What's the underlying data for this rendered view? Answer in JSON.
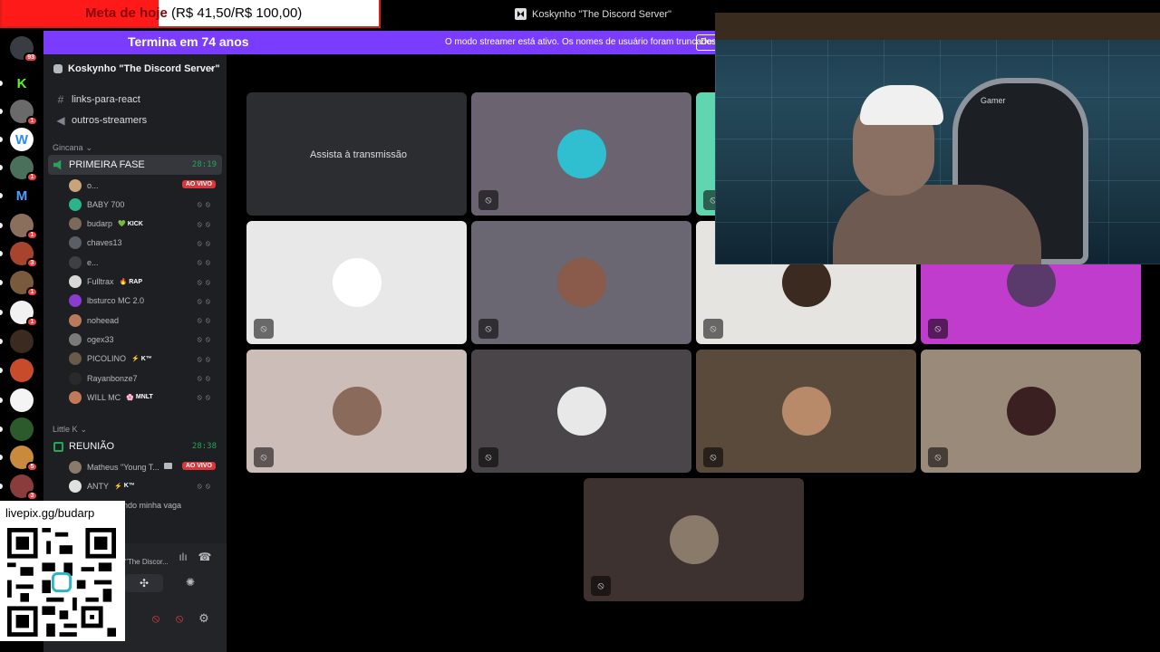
{
  "window": {
    "title": "Koskynho \"The Discord Server\""
  },
  "goal": {
    "label": "Meta de hoje",
    "amount": "(R$ 41,50/R$ 100,00)"
  },
  "banner": {
    "timer": "Termina em 74 anos",
    "notice": "O modo streamer está ativo. Os nomes de usuário foram truncados.",
    "dismiss": "Desativar"
  },
  "rail": {
    "servers": [
      {
        "icon": "discord-logo",
        "badge": "93",
        "color": "#3a3c43"
      },
      {
        "icon": "kick-logo",
        "badge": "",
        "color": "#000000",
        "glyph": "K",
        "glyph_color": "#53fc18"
      },
      {
        "icon": "server-avatar",
        "badge": "1",
        "color": "#6a6a6a"
      },
      {
        "icon": "server-avatar",
        "badge": "",
        "color": "#ffffff",
        "glyph": "W",
        "glyph_color": "#2c8cf4"
      },
      {
        "icon": "server-avatar",
        "badge": "1",
        "color": "#4a6f5b"
      },
      {
        "icon": "server-avatar",
        "badge": "",
        "color": "#000000",
        "glyph": "M",
        "glyph_color": "#4fa1ff"
      },
      {
        "icon": "server-avatar",
        "badge": "1",
        "color": "#8a6f5c"
      },
      {
        "icon": "server-avatar",
        "badge": "3",
        "color": "#a8442e"
      },
      {
        "icon": "server-avatar",
        "badge": "1",
        "color": "#7a5a3c"
      },
      {
        "icon": "server-avatar",
        "badge": "1",
        "color": "#f1f1f1"
      },
      {
        "icon": "server-avatar",
        "badge": "",
        "color": "#3a2a1f"
      },
      {
        "icon": "server-avatar",
        "badge": "",
        "color": "#c84c2c"
      },
      {
        "icon": "server-avatar",
        "badge": "",
        "color": "#f4f4f4"
      },
      {
        "icon": "server-avatar",
        "badge": "",
        "color": "#2c5a2c"
      },
      {
        "icon": "server-avatar",
        "badge": "5",
        "color": "#c88a3c"
      },
      {
        "icon": "server-avatar",
        "badge": "3",
        "color": "#8a3c3c"
      }
    ]
  },
  "sidebar": {
    "server_name": "Koskynho \"The Discord Server\"",
    "channels": [
      {
        "icon": "hash-icon",
        "label": "links-para-react"
      },
      {
        "icon": "megaphone-icon",
        "label": "outros-streamers"
      }
    ],
    "category_1": "Gincana",
    "voice_1": {
      "label": "PRIMEIRA FASE",
      "time": "28:19"
    },
    "voice_1_users": [
      {
        "name": "o...",
        "live": "AO VIVO",
        "tag": "",
        "color": "#c9a47a"
      },
      {
        "name": "BABY 700",
        "live": "",
        "tag": "",
        "color": "#2bb38c"
      },
      {
        "name": "budarp",
        "live": "",
        "tag": "KICK",
        "tag_emoji": "💚",
        "color": "#7b6a5a"
      },
      {
        "name": "chaves13",
        "live": "",
        "tag": "",
        "color": "#5a5f66"
      },
      {
        "name": "e...",
        "live": "",
        "tag": "",
        "color": "#3d3f45"
      },
      {
        "name": "Fulltrax",
        "live": "",
        "tag": "RAP",
        "tag_emoji": "🔥",
        "color": "#d8d8d8"
      },
      {
        "name": "lbsturco MC 2.0",
        "live": "",
        "tag": "",
        "color": "#8a3ccf"
      },
      {
        "name": "noheead",
        "live": "",
        "tag": "",
        "color": "#b87a5a"
      },
      {
        "name": "ogex33",
        "live": "",
        "tag": "",
        "color": "#7a7a7a"
      },
      {
        "name": "PICOLINO",
        "live": "",
        "tag": "K™",
        "tag_emoji": "⚡",
        "color": "#6a5a4a"
      },
      {
        "name": "Rayanbonze7",
        "live": "",
        "tag": "",
        "color": "#2a2a2a"
      },
      {
        "name": "WILL MC",
        "live": "",
        "tag": "MNLT",
        "tag_emoji": "🌸",
        "color": "#c07a5a"
      }
    ],
    "category_2": "Little K",
    "voice_2": {
      "label": "REUNIÃO",
      "time": "28:38"
    },
    "voice_2_users": [
      {
        "name": "Matheus \"Young T...",
        "live": "AO VIVO",
        "tag": "",
        "color": "#8a7a6a"
      },
      {
        "name": "ANTY",
        "live": "",
        "tag": "K™",
        "tag_emoji": "⚡",
        "color": "#e0e0e0"
      }
    ],
    "truncated_status": "...mdo minha vaga",
    "voice_panel": {
      "server": "\"The Discor..."
    }
  },
  "livepix": {
    "url": "livepix.gg/budarp"
  },
  "call": {
    "watch_label": "Assista à transmissão",
    "tiles": [
      {
        "bg": "#2b2d31",
        "avatar": "",
        "watch": true
      },
      {
        "bg": "#6b6470",
        "avatar": "#2fbfd0",
        "watch": false
      },
      {
        "bg": "#5fd6b0",
        "avatar": "",
        "watch": false
      },
      {
        "bg": "#e8e8e8",
        "avatar": "#ffffff",
        "watch": false
      },
      {
        "bg": "#6a6672",
        "avatar": "#8a5a4a",
        "watch": false
      },
      {
        "bg": "#e6e4e0",
        "avatar": "#3a2a20",
        "watch": false
      },
      {
        "bg": "#c03ccc",
        "avatar": "#5a3a6a",
        "watch": false
      },
      {
        "bg": "#cdbdb8",
        "avatar": "#8a6a5a",
        "watch": false
      },
      {
        "bg": "#4a4548",
        "avatar": "#e8e8e8",
        "watch": false
      },
      {
        "bg": "#5a4a3c",
        "avatar": "#b88a6a",
        "watch": false
      },
      {
        "bg": "#9a8a7a",
        "avatar": "#3a2020",
        "watch": false
      },
      {
        "bg": "#3e3230",
        "avatar": "#8a7a6a",
        "watch": false
      }
    ]
  },
  "webcam": {
    "chair_brand": "Gamer"
  },
  "colors": {
    "accent": "#7a3dff",
    "online": "#23a55a",
    "live": "#da373c",
    "goal": "#ff1a1a"
  }
}
